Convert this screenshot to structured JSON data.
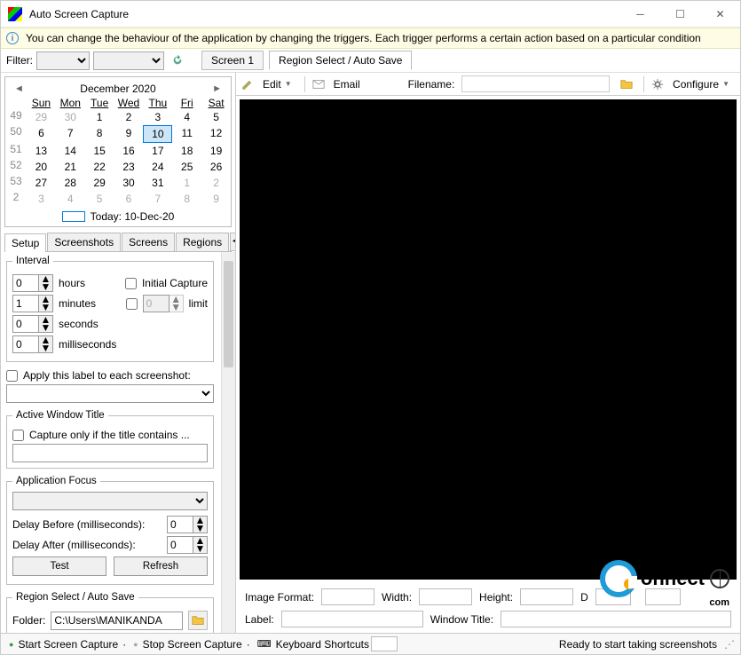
{
  "titlebar": {
    "title": "Auto Screen Capture"
  },
  "infobar": {
    "text": "You can change the behaviour of the application by changing the triggers. Each trigger performs a certain action based on a particular condition"
  },
  "filter": {
    "label": "Filter:"
  },
  "screen_tabs": {
    "screen1": "Screen 1",
    "region": "Region Select / Auto Save"
  },
  "calendar": {
    "month": "December 2020",
    "dow": [
      "Sun",
      "Mon",
      "Tue",
      "Wed",
      "Thu",
      "Fri",
      "Sat"
    ],
    "weeks": [
      "49",
      "50",
      "51",
      "52",
      "53",
      "2"
    ],
    "grid": [
      [
        "29",
        "30",
        "1",
        "2",
        "3",
        "4",
        "5"
      ],
      [
        "6",
        "7",
        "8",
        "9",
        "10",
        "11",
        "12"
      ],
      [
        "13",
        "14",
        "15",
        "16",
        "17",
        "18",
        "19"
      ],
      [
        "20",
        "21",
        "22",
        "23",
        "24",
        "25",
        "26"
      ],
      [
        "27",
        "28",
        "29",
        "30",
        "31",
        "1",
        "2"
      ],
      [
        "3",
        "4",
        "5",
        "6",
        "7",
        "8",
        "9"
      ]
    ],
    "dim_first": [
      "29",
      "30"
    ],
    "dim_last_row4": [
      "1",
      "2"
    ],
    "today_cell": "10",
    "footer": "Today: 10-Dec-20"
  },
  "subtabs": {
    "setup": "Setup",
    "screenshots": "Screenshots",
    "screens": "Screens",
    "regions": "Regions"
  },
  "interval": {
    "legend": "Interval",
    "hours": "0",
    "hours_label": "hours",
    "minutes": "1",
    "minutes_label": "minutes",
    "seconds": "0",
    "seconds_label": "seconds",
    "ms": "0",
    "ms_label": "milliseconds",
    "initial": "Initial Capture",
    "limit_val": "0",
    "limit_label": "limit"
  },
  "label_apply": "Apply this label to each screenshot:",
  "awt": {
    "legend": "Active Window Title",
    "capture_if": "Capture only if the title contains ..."
  },
  "appfocus": {
    "legend": "Application Focus",
    "delay_before": "Delay Before (milliseconds):",
    "db_val": "0",
    "delay_after": "Delay After (milliseconds):",
    "da_val": "0",
    "test": "Test",
    "refresh": "Refresh"
  },
  "region": {
    "legend": "Region Select / Auto Save",
    "folder_label": "Folder:",
    "folder_val": "C:\\Users\\MANIKANDA"
  },
  "rtoolbar": {
    "edit": "Edit",
    "email": "Email",
    "filename": "Filename:",
    "configure": "Configure"
  },
  "rbottom": {
    "imgfmt": "Image Format:",
    "width": "Width:",
    "height": "Height:",
    "d1": "D",
    "d2": "",
    "label": "Label:",
    "wintitle": "Window Title:"
  },
  "statusbar": {
    "start": "Start Screen Capture",
    "stop": "Stop Screen Capture",
    "kbd": "Keyboard Shortcuts",
    "ready": "Ready to start taking screenshots"
  },
  "watermark": {
    "text": "onnect",
    "sub": "com"
  }
}
